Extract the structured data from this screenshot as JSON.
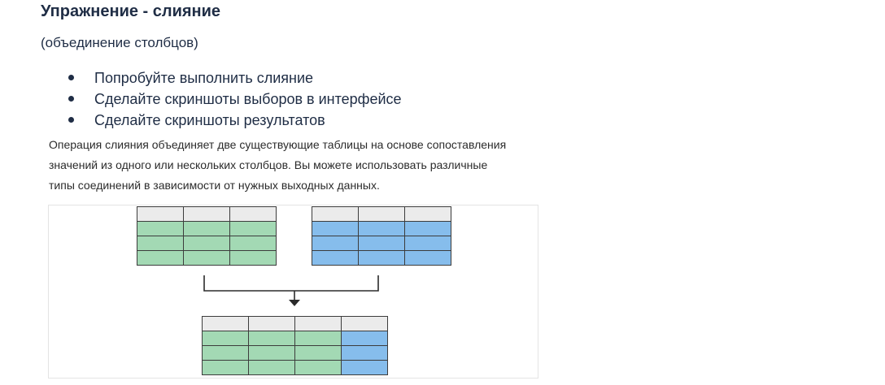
{
  "title": "Упражнение - слияние",
  "subtitle": "(объединение столбцов)",
  "bullets": [
    "Попробуйте выполнить слияние",
    "Сделайте скриншоты выборов в интерфейсе",
    "Сделайте скриншоты результатов"
  ],
  "description": [
    "Операция слияния объединяет две существующие таблицы на основе сопоставления",
    "значений из одного или нескольких столбцов. Вы можете использовать различные",
    "типы соединений в зависимости от нужных выходных данных."
  ],
  "diagram": {
    "colors": {
      "header": "#ebebeb",
      "green": "#a3d9b4",
      "blue": "#86bdec",
      "grid": "#3c3c3c",
      "arrow": "#2b2b2b"
    },
    "left_table": {
      "columns": 3,
      "body_rows": 3,
      "fill": "green"
    },
    "right_table": {
      "columns": 3,
      "body_rows": 3,
      "fill": "blue"
    },
    "result_table": {
      "columns": [
        "green",
        "green",
        "green",
        "blue"
      ],
      "body_rows": 3
    }
  }
}
